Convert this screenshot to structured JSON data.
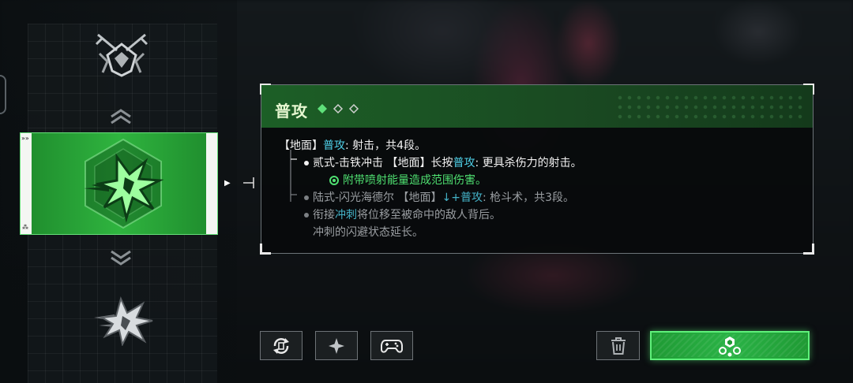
{
  "colors": {
    "accent_green": "#2fb43f",
    "highlight_cyan": "#4fd0e8",
    "bright_green_text": "#4fe071",
    "panel_bg": "#080a0b"
  },
  "skill_column": {
    "top_icon": "crossed-blades-emblem-icon",
    "up_icon": "chevron-up-icon",
    "selected_icon": "burst-shot-icon",
    "down_icon": "chevron-down-icon",
    "bottom_icon": "impact-burst-icon"
  },
  "tooltip": {
    "title": "普攻",
    "level_indicator": "1 of 3 diamonds filled",
    "rank_filled": 1,
    "rank_total": 3,
    "line1": {
      "prefix": "【地面】",
      "hl": "普攻",
      "suffix": ": 射击，共4段。"
    },
    "line2": {
      "prefix": "贰式-击铁冲击 【地面】长按",
      "hl": "普攻",
      "suffix": ": 更具杀伤力的射击。"
    },
    "line3": {
      "text": "附带喷射能量造成范围伤害。"
    },
    "line4": {
      "prefix": "陆式-闪光海德尔 【地面】",
      "hl": "↓+普攻",
      "suffix": ": 枪斗术，共3段。"
    },
    "line5": {
      "prefix": "衔接",
      "hl": "冲刺",
      "suffix": "将位移至被命中的敌人背后。"
    },
    "line6": {
      "text": "冲刺的闪避状态延长。"
    }
  },
  "buttons": {
    "swap": "swap-cycle-icon",
    "spark": "sparkle-icon",
    "gamepad": "gamepad-icon",
    "delete": "trash-icon",
    "equip": "chip-module-icon"
  }
}
